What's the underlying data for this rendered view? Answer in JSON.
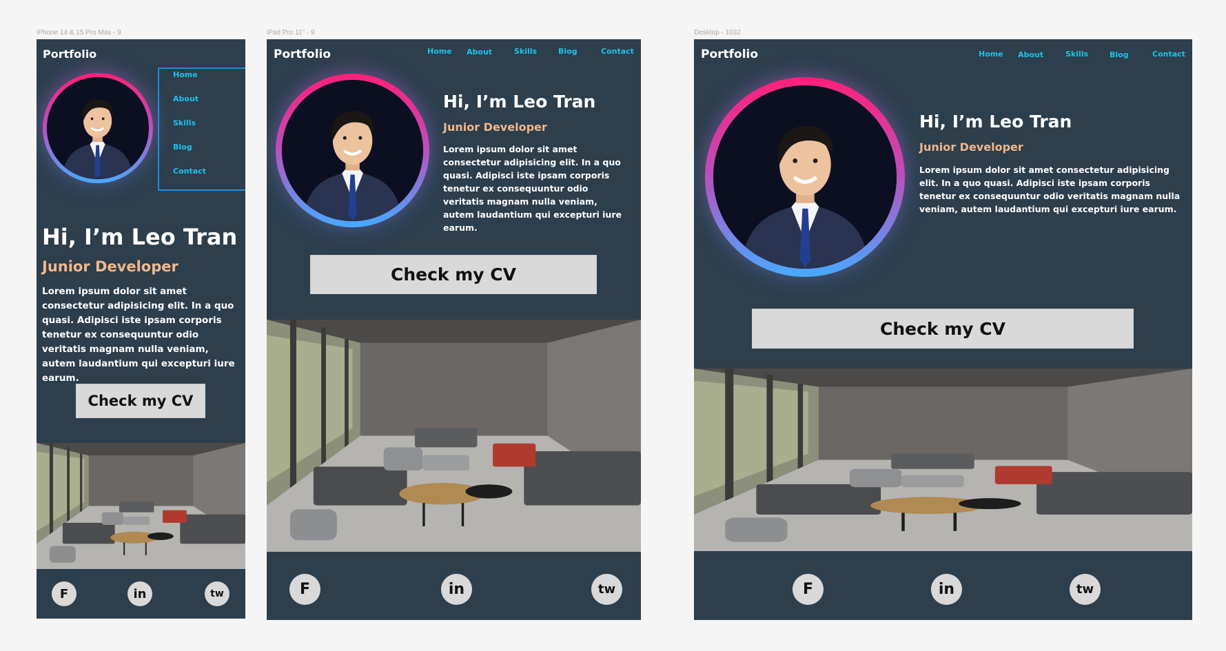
{
  "frames": {
    "mobile": {
      "label": "iPhone 14 & 15 Pro Max - 9"
    },
    "tablet": {
      "label": "iPad Pro 11\" - 9"
    },
    "desktop": {
      "label": "Desktop - 1032"
    }
  },
  "site": {
    "logo": "Portfolio",
    "nav": [
      "Home",
      "About",
      "Skills",
      "Blog",
      "Contact"
    ],
    "greeting": "Hi, I’m Leo Tran",
    "role": "Junior Developer",
    "bio": "Lorem ipsum dolor sit amet consectetur adipisicing elit. In a quo quasi. Adipisci iste ipsam corporis tenetur ex consequuntur odio veritatis magnam nulla veniam, autem laudantium qui excepturi iure earum.",
    "cv_button": "Check my CV",
    "social": {
      "facebook": "F",
      "linkedin": "in",
      "twitter": "tw"
    }
  },
  "colors": {
    "panel": "#2d3e4c",
    "accent": "#1fc2ea",
    "role": "#f2b78a",
    "ring_top": "#ff1f79",
    "ring_bottom": "#48a9ff",
    "button": "#d9d9d9"
  },
  "icons": [
    "profile-photo",
    "lounge-interior-photo",
    "facebook-icon",
    "linkedin-icon",
    "twitter-icon"
  ]
}
